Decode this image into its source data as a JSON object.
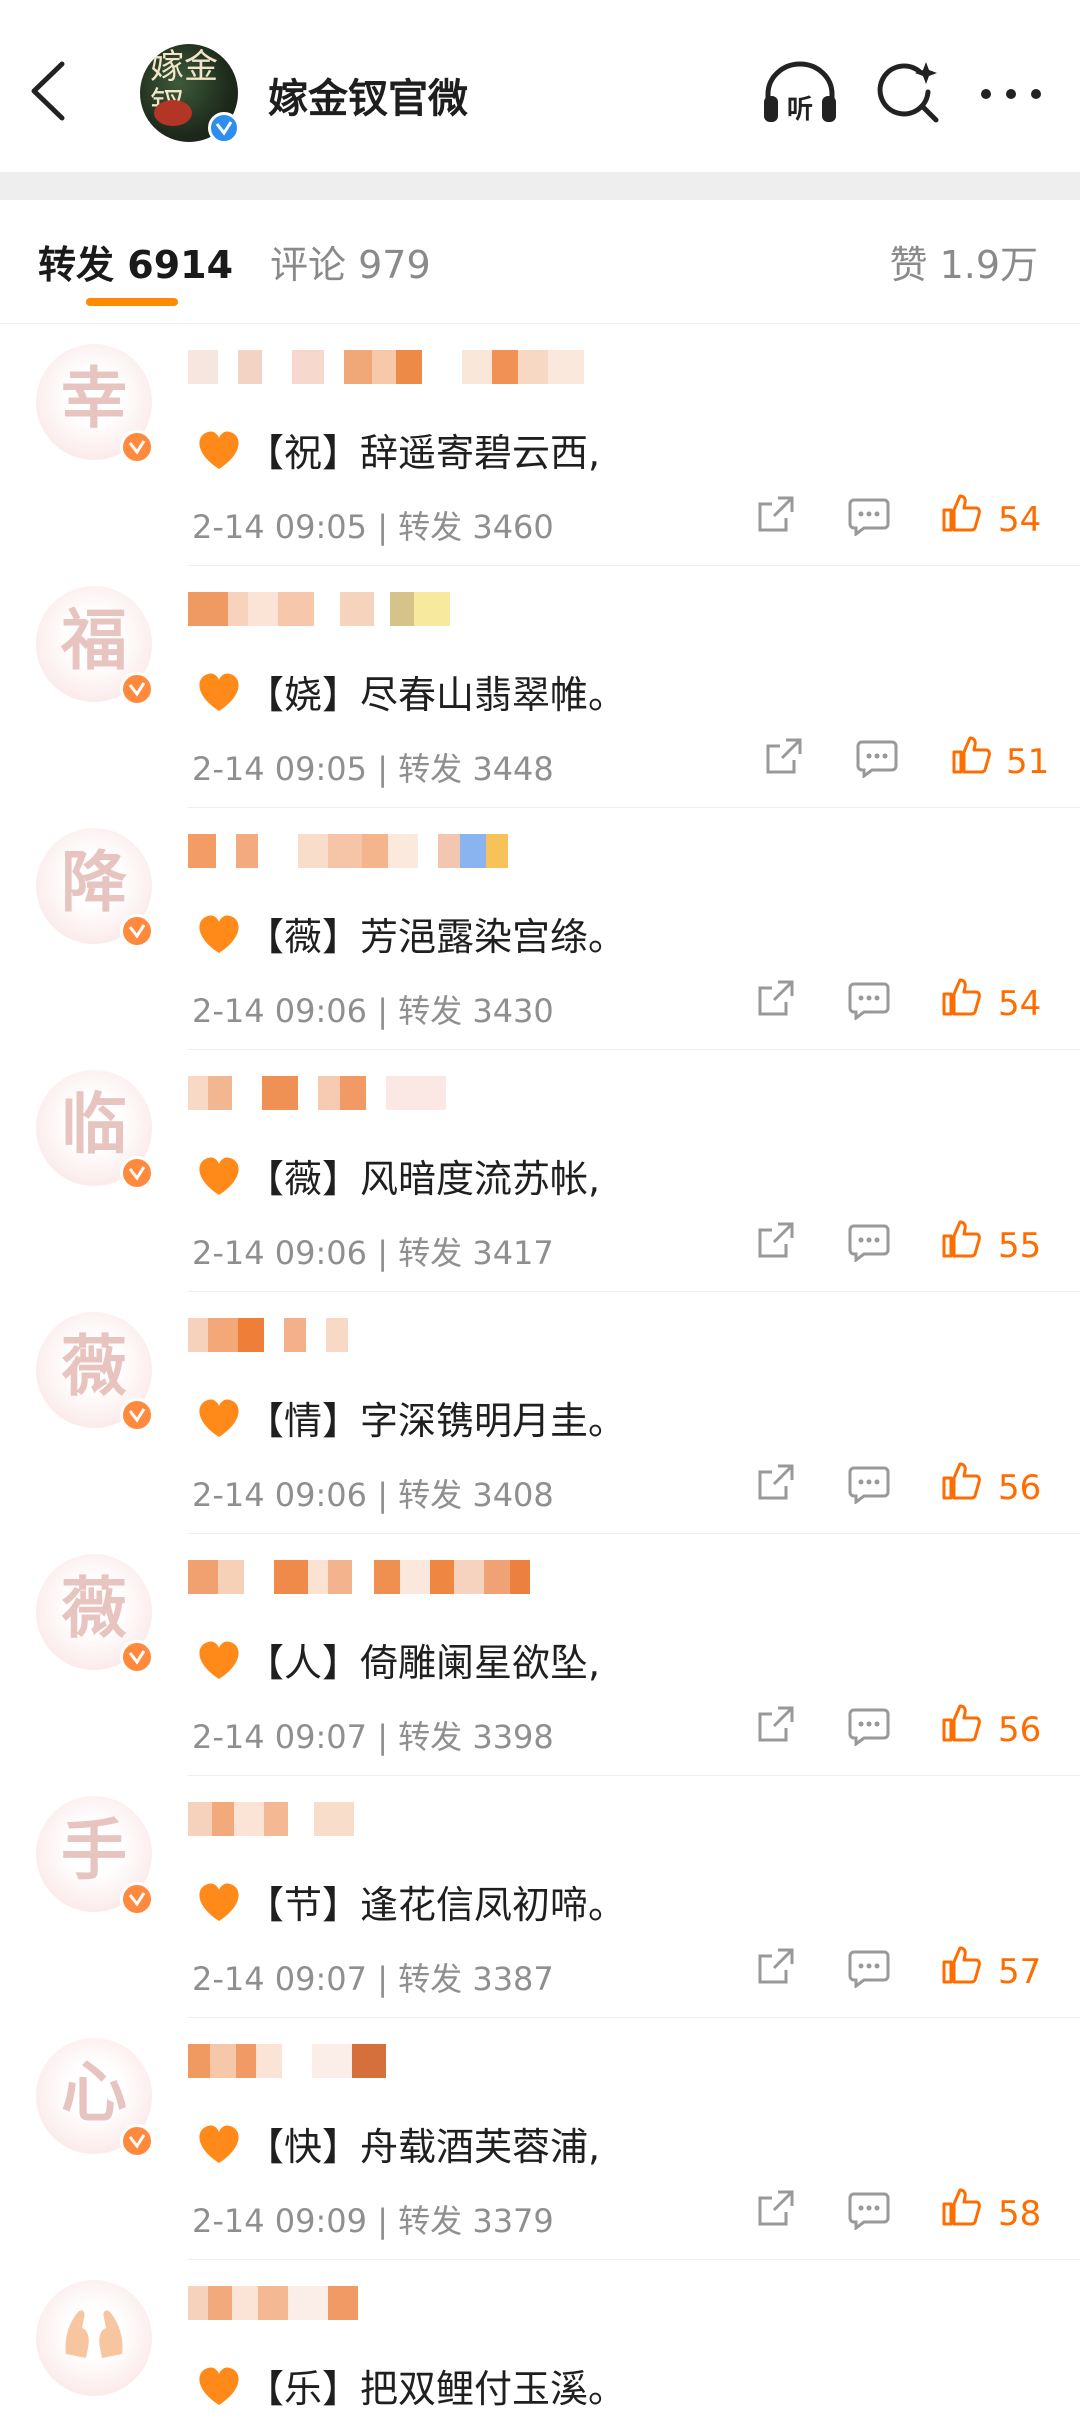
{
  "header": {
    "title": "嫁金钗官微",
    "avatar_text": "嫁金钗",
    "listen_label": "听"
  },
  "tabs": {
    "repost_label": "转发",
    "repost_count": "6914",
    "comment_label": "评论",
    "comment_count": "979",
    "like_label": "赞",
    "like_count": "1.9万"
  },
  "colors": {
    "accent": "#ff8a00",
    "like": "#ff6d00",
    "badge_blue": "#2d8ef0",
    "badge_orange": "#ff8a3d",
    "meta_gray": "#8f8f8f"
  },
  "reposts": [
    {
      "avatar_char": "幸",
      "tag": "【祝】",
      "text": "辞遥寄碧云西,",
      "time": "2-14 09:05",
      "repost_label": "转发",
      "repost_count": "3460",
      "likes": "54"
    },
    {
      "avatar_char": "福",
      "tag": "【娆】",
      "text": "尽春山翡翠帷。",
      "time": "2-14 09:05",
      "repost_label": "转发",
      "repost_count": "3448",
      "likes": "51"
    },
    {
      "avatar_char": "降",
      "tag": "【薇】",
      "text": "芳浥露染宫绦。",
      "time": "2-14 09:06",
      "repost_label": "转发",
      "repost_count": "3430",
      "likes": "54"
    },
    {
      "avatar_char": "临",
      "tag": "【薇】",
      "text": "风暗度流苏帐,",
      "time": "2-14 09:06",
      "repost_label": "转发",
      "repost_count": "3417",
      "likes": "55"
    },
    {
      "avatar_char": "薇",
      "tag": "【情】",
      "text": "字深镌明月圭。",
      "time": "2-14 09:06",
      "repost_label": "转发",
      "repost_count": "3408",
      "likes": "56"
    },
    {
      "avatar_char": "薇",
      "tag": "【人】",
      "text": "倚雕阑星欲坠,",
      "time": "2-14 09:07",
      "repost_label": "转发",
      "repost_count": "3398",
      "likes": "56"
    },
    {
      "avatar_char": "手",
      "tag": "【节】",
      "text": "逢花信凤初啼。",
      "time": "2-14 09:07",
      "repost_label": "转发",
      "repost_count": "3387",
      "likes": "57"
    },
    {
      "avatar_char": "心",
      "tag": "【快】",
      "text": "舟载酒芙蓉浦,",
      "time": "2-14 09:09",
      "repost_label": "转发",
      "repost_count": "3379",
      "likes": "58"
    },
    {
      "avatar_char": "",
      "tag": "【乐】",
      "text": "把双鲤付玉溪。",
      "time": "",
      "repost_label": "",
      "repost_count": "",
      "likes": ""
    }
  ],
  "icons": [
    "back-arrow-icon",
    "verified-badge-icon",
    "listen-headphones-icon",
    "search-sparkle-icon",
    "more-dots-icon",
    "orange-heart-icon",
    "repost-share-icon",
    "comment-bubble-icon",
    "thumbs-up-icon"
  ]
}
